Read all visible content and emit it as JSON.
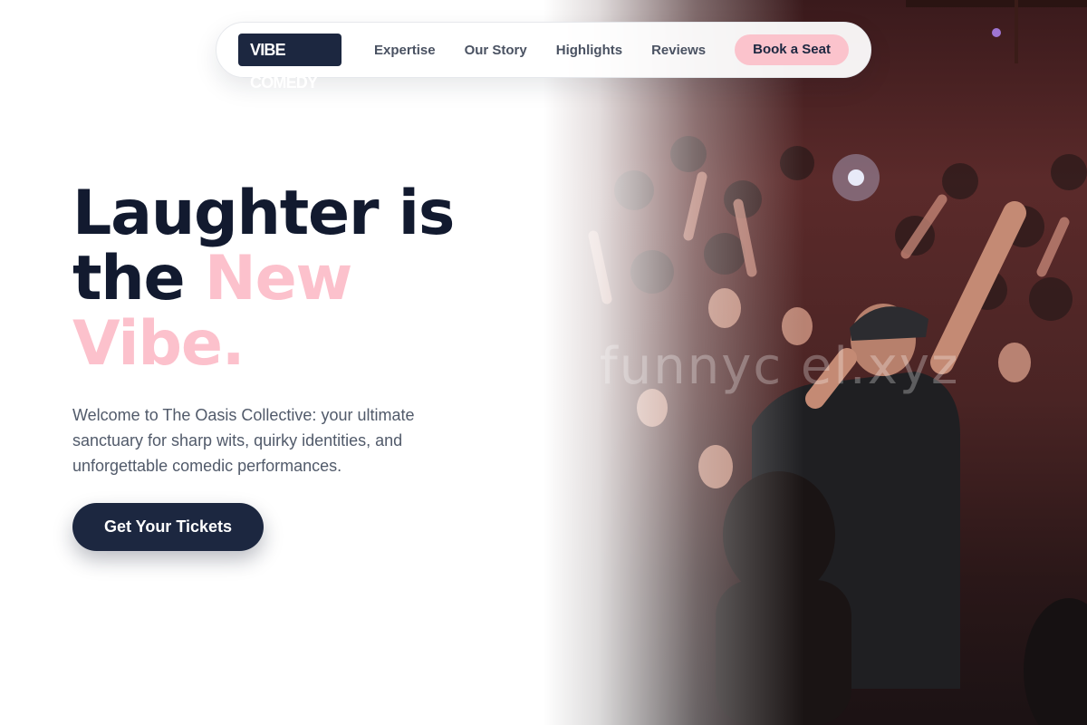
{
  "nav": {
    "logo": "VIBE COMEDY",
    "links": [
      "Expertise",
      "Our Story",
      "Highlights",
      "Reviews"
    ],
    "cta": "Book a Seat"
  },
  "hero": {
    "headline_part1": "Laughter is",
    "headline_part2": "the ",
    "headline_accent_1": "New",
    "headline_accent_2": "Vibe.",
    "subtitle": "Welcome to The Oasis Collective: your ultimate sanctuary for sharp wits, quirky identities, and unforgettable comedic performances.",
    "cta": "Get Your Tickets"
  },
  "photo": {
    "watermark": "funnyc      el.xyz"
  },
  "colors": {
    "navy": "#1c2740",
    "pink": "#fbc3cc",
    "text_muted": "#515a6a"
  }
}
